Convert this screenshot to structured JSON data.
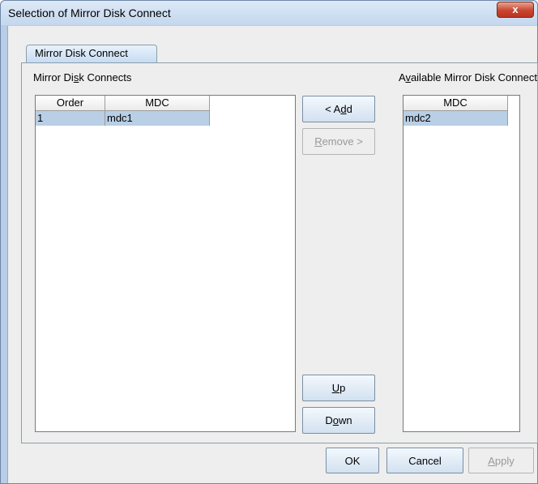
{
  "window": {
    "title": "Selection of Mirror Disk Connect",
    "close_glyph": "x"
  },
  "tabs": [
    {
      "label": "Mirror Disk Connect"
    }
  ],
  "left_list": {
    "label_before": "Mirror Di",
    "label_mnemonic": "s",
    "label_after": "k Connects",
    "columns": [
      "Order",
      "MDC"
    ],
    "rows": [
      {
        "order": "1",
        "mdc": "mdc1"
      }
    ]
  },
  "right_list": {
    "label_before": "A",
    "label_mnemonic": "v",
    "label_after": "ailable Mirror Disk Connect",
    "columns": [
      "MDC"
    ],
    "rows": [
      {
        "mdc": "mdc2"
      }
    ]
  },
  "buttons": {
    "add": {
      "before": "< A",
      "mnemonic": "d",
      "after": "d"
    },
    "remove": {
      "before": "",
      "mnemonic": "R",
      "after": "emove >",
      "enabled": false
    },
    "up": {
      "before": "",
      "mnemonic": "U",
      "after": "p"
    },
    "down": {
      "before": "D",
      "mnemonic": "o",
      "after": "wn"
    },
    "ok": "OK",
    "cancel": "Cancel",
    "apply": {
      "before": "",
      "mnemonic": "A",
      "after": "pply",
      "enabled": false
    }
  },
  "colors": {
    "selection": "#b8cfe5",
    "frame": "#b7cde8",
    "close_button": "#c8462f"
  },
  "icons": [
    "close-icon"
  ]
}
